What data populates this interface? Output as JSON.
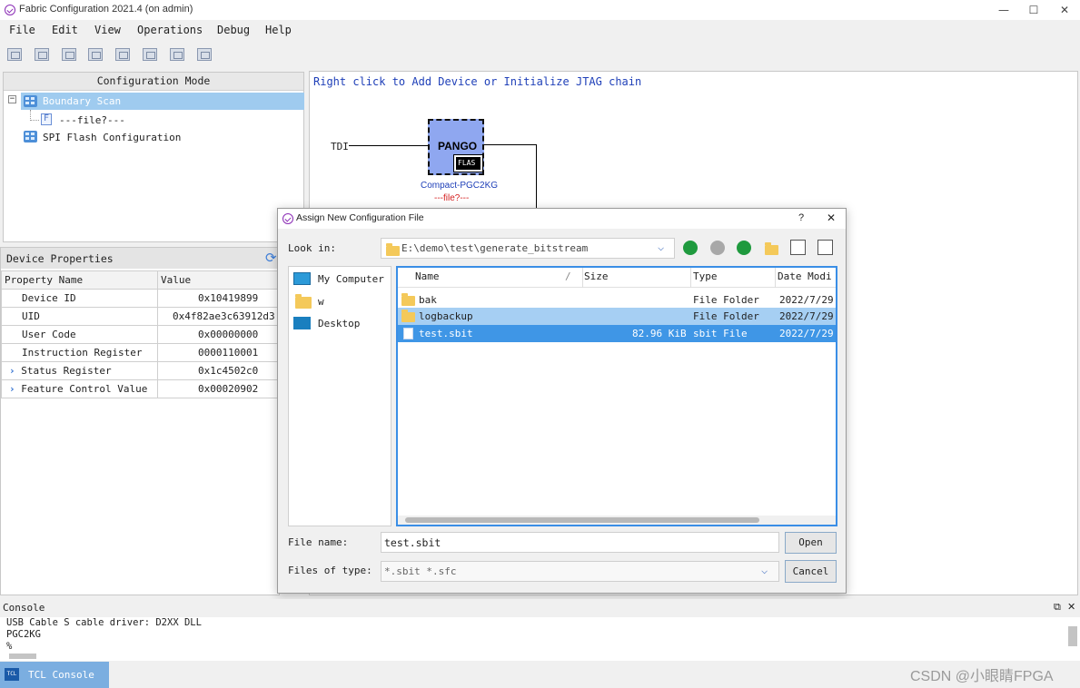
{
  "window": {
    "title": "Fabric Configuration 2021.4 (on admin)",
    "minimize": "—",
    "maximize": "☐",
    "close": "✕"
  },
  "menu": [
    "File",
    "Edit",
    "View",
    "Operations",
    "Debug",
    "Help"
  ],
  "toolbar_icons": [
    "scan-chain-icon",
    "program-icon",
    "grid-icon",
    "chip-icon",
    "list-icon",
    "connect-icon",
    "disconnect-icon",
    "erase-icon"
  ],
  "config_mode": {
    "header": "Configuration Mode",
    "items": [
      {
        "label": "Boundary Scan",
        "selected": true
      },
      {
        "label": "---file?---"
      },
      {
        "label": "SPI Flash Configuration"
      }
    ]
  },
  "device_props": {
    "header": "Device Properties",
    "columns": [
      "Property Name",
      "Value"
    ],
    "rows": [
      {
        "name": "Device ID",
        "value": "0x10419899"
      },
      {
        "name": "UID",
        "value": "0x4f82ae3c63912d3"
      },
      {
        "name": "User Code",
        "value": "0x00000000"
      },
      {
        "name": "Instruction Register",
        "value": "0000110001"
      },
      {
        "name": "Status Register",
        "value": "0x1c4502c0"
      },
      {
        "name": "Feature Control Value",
        "value": "0x00020902"
      }
    ]
  },
  "canvas": {
    "hint": "Right click to Add Device or Initialize JTAG chain",
    "tdi": "TDI",
    "chip_label": "PANGO",
    "flash_label": "FLAS",
    "device_name": "Compact-PGC2KG",
    "device_file": "---file?---"
  },
  "dialog": {
    "title": "Assign New Configuration File",
    "help": "?",
    "close": "✕",
    "look_in_label": "Look in:",
    "look_in_path": "E:\\demo\\test\\generate_bitstream",
    "places": [
      "My Computer",
      "w",
      "Desktop"
    ],
    "columns": [
      "Name",
      "Size",
      "Type",
      "Date Modi"
    ],
    "files": [
      {
        "name": "bak",
        "size": "",
        "type": "File Folder",
        "date": "2022/7/29"
      },
      {
        "name": "logbackup",
        "size": "",
        "type": "File Folder",
        "date": "2022/7/29"
      },
      {
        "name": "test.sbit",
        "size": "82.96 KiB",
        "type": "sbit File",
        "date": "2022/7/29"
      }
    ],
    "file_name_label": "File name:",
    "file_name_value": "test.sbit",
    "file_type_label": "Files of type:",
    "file_type_value": "*.sbit *.sfc",
    "open": "Open",
    "cancel": "Cancel"
  },
  "console": {
    "header": "Console",
    "lines": [
      "USB Cable S cable driver: D2XX DLL",
      "PGC2KG",
      "%"
    ],
    "tab": "TCL Console"
  },
  "watermark": "CSDN @小眼睛FPGA"
}
